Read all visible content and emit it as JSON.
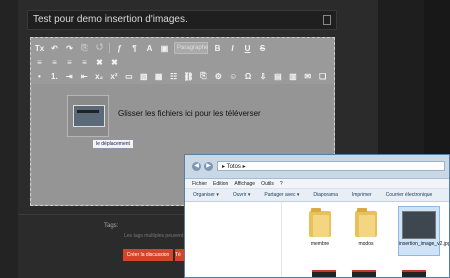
{
  "header": {
    "title": "Test pour demo insertion d'images."
  },
  "editor": {
    "toolbar": {
      "row1": [
        "Tx",
        "↶",
        "↷",
        "⎘",
        "⭯",
        "ƒ",
        "¶",
        "A",
        "▣",
        "Paragraphe",
        "B",
        "I",
        "U",
        "S"
      ],
      "font_select": "Paragraphe",
      "row2": [
        "≡",
        "≡",
        "≡",
        "≡",
        "✖",
        "✖"
      ],
      "row3": [
        "•",
        "1.",
        "⇥",
        "⇤",
        "x₂",
        "x²",
        "▭",
        "▧",
        "▦",
        "☷",
        "⛓",
        "⎘",
        "⚙",
        "☺",
        "Ω",
        "⇩",
        "▤",
        "▥",
        "✉",
        "❏"
      ]
    },
    "drop_text": "Glisser les fichiers ici pour les téléverser",
    "move_tooltip": "le déplacement"
  },
  "tags": {
    "label": "Tags:",
    "hint": "Les tags multiples peuvent"
  },
  "actions": {
    "create_label": "Créer la discussion",
    "partial_label": "Té"
  },
  "explorer": {
    "back": "◀",
    "forward": "▶",
    "path": "▸ Totos ▸",
    "menu": [
      "Fichier",
      "Edition",
      "Affichage",
      "Outils",
      "?"
    ],
    "commands": [
      "Organiser ▾",
      "Ouvrir ▾",
      "Partager avec ▾",
      "Diaporama",
      "Imprimer",
      "Courrier électronique"
    ],
    "items": [
      {
        "name": "membre",
        "kind": "folder"
      },
      {
        "name": "modos",
        "kind": "folder"
      },
      {
        "name": "insertion_image_v2.jpg",
        "kind": "image"
      }
    ]
  },
  "colors": {
    "accent": "#d2452a",
    "editor_bg": "#9a9a9a",
    "page_bg": "#2b2b2b"
  }
}
